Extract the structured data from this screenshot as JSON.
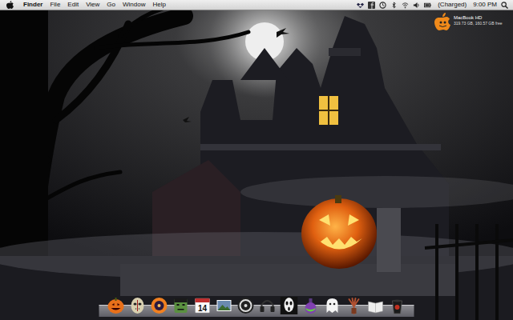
{
  "menu_bar": {
    "app": "Finder",
    "menus": [
      "File",
      "Edit",
      "View",
      "Go",
      "Window",
      "Help"
    ],
    "status_items": [
      {
        "kind": "dropbox"
      },
      {
        "kind": "facebook"
      },
      {
        "kind": "timemachine"
      },
      {
        "kind": "bluetooth"
      },
      {
        "kind": "wifi"
      },
      {
        "kind": "volume"
      },
      {
        "kind": "battery"
      }
    ],
    "battery_status": "(Charged)",
    "clock": "9:00 PM"
  },
  "desktop": {
    "disk": {
      "name": "MacBook HD",
      "info": "319.73 GB, 160.57 GB free"
    }
  },
  "dock": [
    {
      "kind": "pumpkin"
    },
    {
      "kind": "hockey-mask"
    },
    {
      "kind": "disc"
    },
    {
      "kind": "monster"
    },
    {
      "kind": "calendar",
      "date": "14"
    },
    {
      "kind": "photo"
    },
    {
      "kind": "clock"
    },
    {
      "kind": "headphones"
    },
    {
      "kind": "scream"
    },
    {
      "kind": "potion"
    },
    {
      "kind": "ghost"
    },
    {
      "kind": "claw"
    },
    {
      "kind": "book"
    },
    {
      "kind": "trash"
    }
  ]
}
